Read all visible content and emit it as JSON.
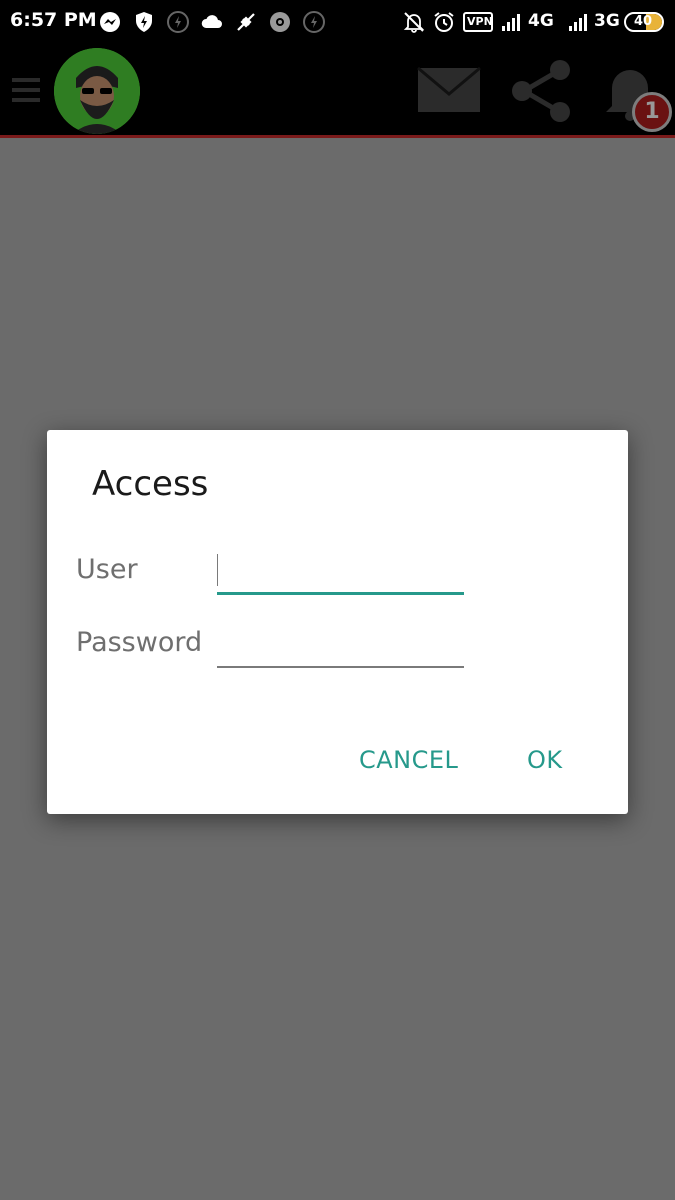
{
  "status_bar": {
    "time": "6:57 PM",
    "vpn_label": "VPN",
    "network_1": "4G",
    "network_2": "3G",
    "battery": "40",
    "icons": [
      "messenger-icon",
      "shield-bolt-icon",
      "flash-off-icon",
      "cloud-icon",
      "usb-debug-icon",
      "settings-icon",
      "flash-off-icon",
      "bell-off-icon",
      "alarm-icon",
      "vpn-icon",
      "signal-icon",
      "signal-icon",
      "battery-icon"
    ]
  },
  "app_bar": {
    "icons": [
      "menu-icon",
      "avatar",
      "mail-icon",
      "share-icon",
      "bell-icon"
    ],
    "notification_count": "1"
  },
  "dialog": {
    "title": "Access",
    "user_label": "User",
    "user_value": "",
    "password_label": "Password",
    "password_value": "",
    "cancel_label": "CANCEL",
    "ok_label": "OK"
  },
  "colors": {
    "accent": "#26998b",
    "background_scrim": "#6b6b6b",
    "app_bar": "#000000"
  }
}
